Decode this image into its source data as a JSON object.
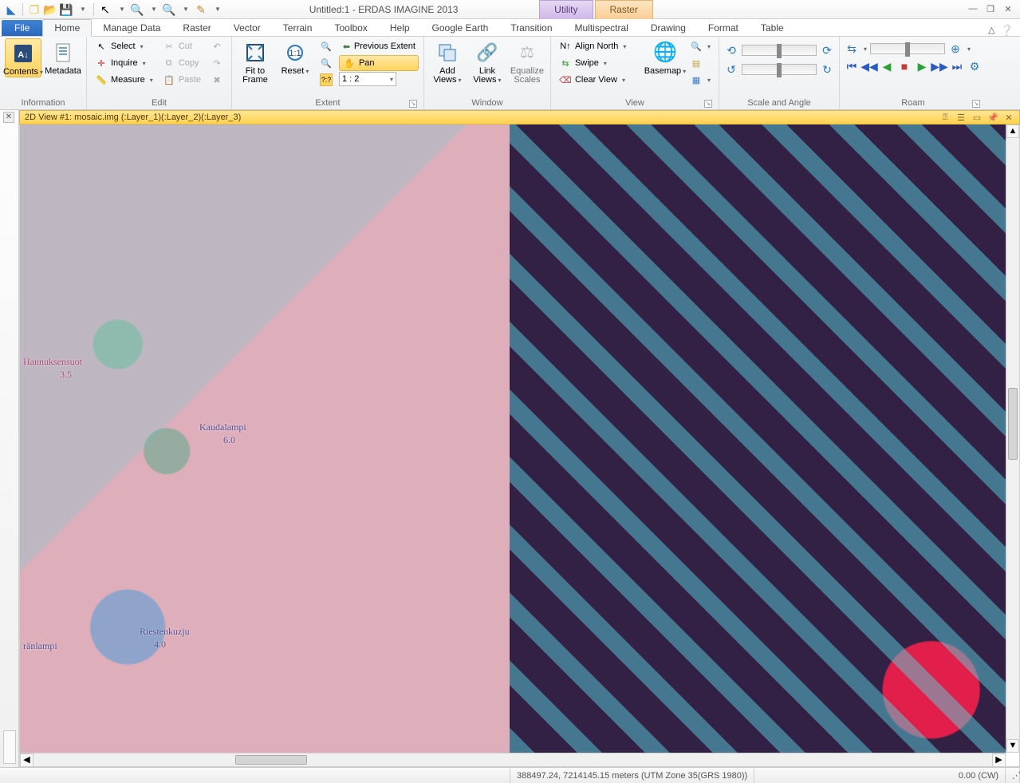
{
  "title": "Untitled:1 - ERDAS IMAGINE 2013",
  "context_tabs": {
    "utility": "Utility",
    "raster": "Raster"
  },
  "tabs": {
    "file": "File",
    "items": [
      "Home",
      "Manage Data",
      "Raster",
      "Vector",
      "Terrain",
      "Toolbox",
      "Help",
      "Google Earth",
      "Transition",
      "Multispectral",
      "Drawing",
      "Format",
      "Table"
    ],
    "active": "Home"
  },
  "ribbon": {
    "information": {
      "label": "Information",
      "contents": "Contents",
      "metadata": "Metadata"
    },
    "edit": {
      "label": "Edit",
      "select": "Select",
      "inquire": "Inquire",
      "measure": "Measure",
      "cut": "Cut",
      "copy": "Copy",
      "paste": "Paste"
    },
    "extent": {
      "label": "Extent",
      "fit": "Fit to\nFrame",
      "reset": "Reset",
      "prev": "Previous Extent",
      "pan": "Pan",
      "scale_value": "1 : 2"
    },
    "window": {
      "label": "Window",
      "add": "Add\nViews",
      "link": "Link\nViews",
      "eq": "Equalize\nScales"
    },
    "view": {
      "label": "View",
      "align": "Align North",
      "swipe": "Swipe",
      "clear": "Clear View",
      "basemap": "Basemap"
    },
    "scale": {
      "label": "Scale and Angle"
    },
    "roam": {
      "label": "Roam"
    }
  },
  "view_title": "2D View #1: mosaic.img (:Layer_1)(:Layer_2)(:Layer_3)",
  "map_labels": {
    "hannuksensuot": "Hannuksensuot",
    "hannuksensuot_val": "3.5",
    "kaudalampi": "Kaudalampi",
    "kaudalampi_val": "6.0",
    "riestenkuzju": "Riestenkuzju",
    "riestenkuzju_val": "4.0",
    "ranlampi": "ränlampi"
  },
  "status": {
    "coords": "388497.24, 7214145.15 meters (UTM Zone 35(GRS 1980))",
    "rotation": "0.00 (CW)"
  }
}
